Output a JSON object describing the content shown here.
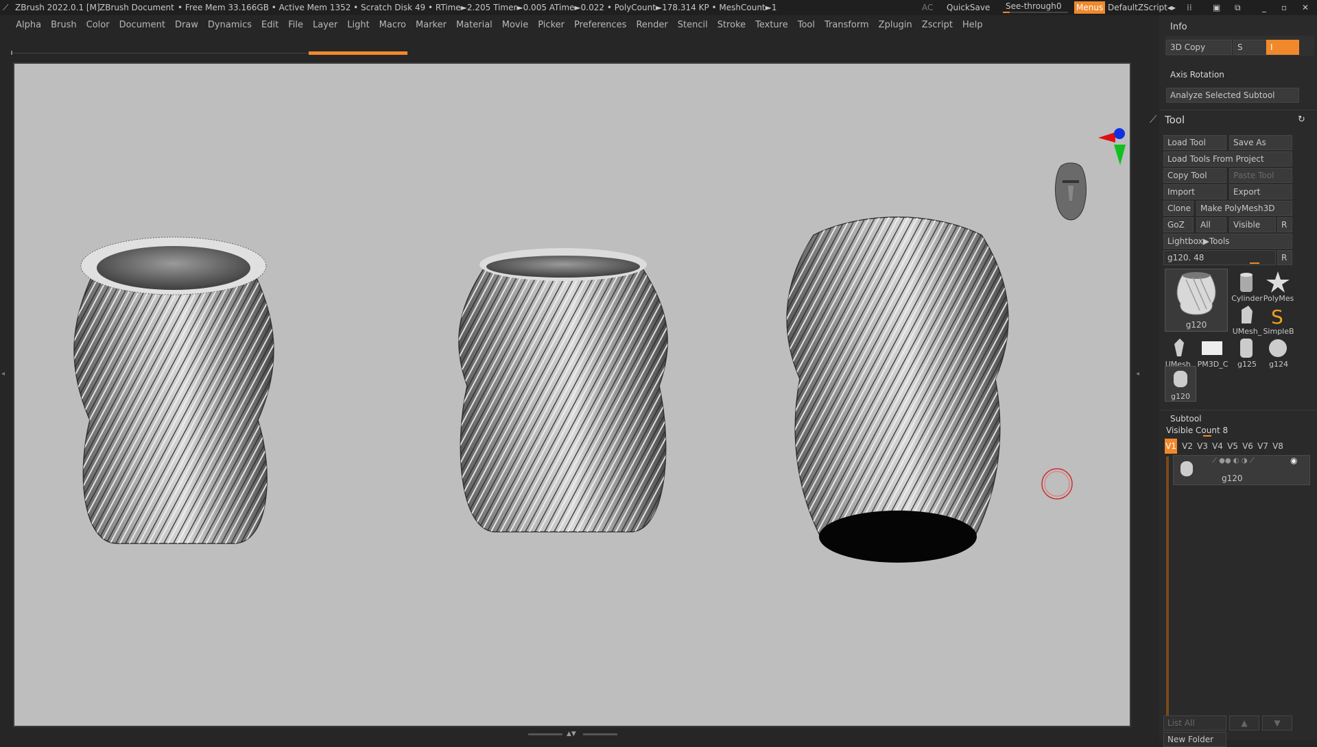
{
  "titlebar": {
    "app": "ZBrush 2022.0.1 [M]",
    "document": "ZBrush Document",
    "stats": "• Free Mem 33.166GB • Active Mem 1352 • Scratch Disk 49 • RTime►2.205 Timer►0.005 ATime►0.022 • PolyCount►178.314 KP • MeshCount►1",
    "ac": "AC",
    "quicksave": "QuickSave",
    "seethrough": "See-through",
    "seethrough_value": "0",
    "menus": "Menus",
    "script": "DefaultZScript"
  },
  "menu": [
    "Alpha",
    "Brush",
    "Color",
    "Document",
    "Draw",
    "Dynamics",
    "Edit",
    "File",
    "Layer",
    "Light",
    "Macro",
    "Marker",
    "Material",
    "Movie",
    "Picker",
    "Preferences",
    "Render",
    "Stencil",
    "Stroke",
    "Texture",
    "Tool",
    "Transform",
    "Zplugin",
    "Zscript",
    "Help"
  ],
  "colors": {
    "accent": "#f0892b",
    "viewport_bg": "#bebebe",
    "panel_bg": "#2a2a2a"
  },
  "panel": {
    "info_title": "Info",
    "copy3d": "3D Copy",
    "s_label": "S",
    "axis_rotation": "Axis Rotation",
    "analyze": "Analyze Selected Subtool",
    "tool_title": "Tool",
    "load_tool": "Load Tool",
    "save_as": "Save As",
    "load_project": "Load Tools From Project",
    "copy_tool": "Copy Tool",
    "paste_tool": "Paste Tool",
    "import": "Import",
    "export": "Export",
    "clone": "Clone",
    "make_polymesh": "Make PolyMesh3D",
    "goz": "GoZ",
    "all": "All",
    "visible": "Visible",
    "r": "R",
    "lightbox": "Lightbox▶Tools",
    "current_tool": "g120. 48",
    "thumbs": [
      "g120",
      "Cylinder",
      "PolyMes",
      "UMesh_",
      "SimpleB",
      "UMesh_",
      "PM3D_C",
      "g125",
      "g124",
      "g120"
    ],
    "subtool_title": "Subtool",
    "visible_count": "Visible Count 8",
    "versions": [
      "V1",
      "V2",
      "V3",
      "V4",
      "V5",
      "V6",
      "V7",
      "V8"
    ],
    "subtool_item": "g120",
    "list_all": "List All",
    "new_folder": "New Folder"
  }
}
